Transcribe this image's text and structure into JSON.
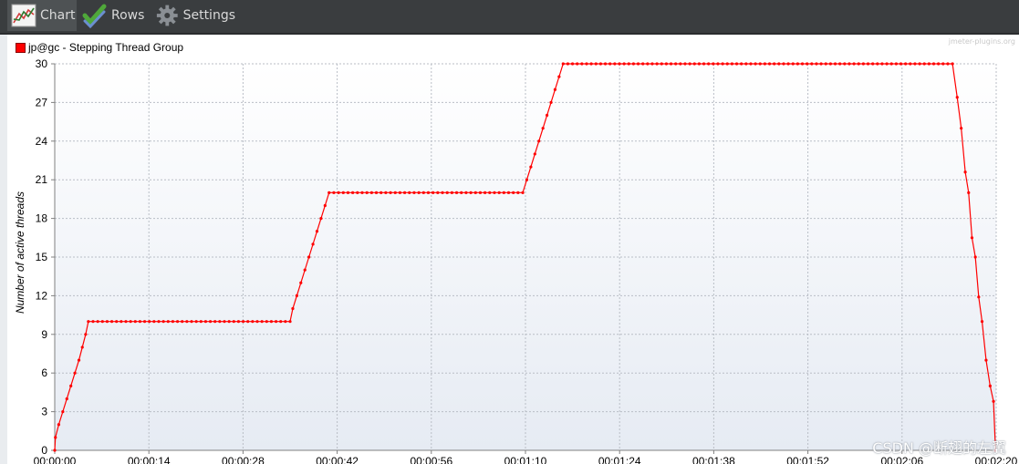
{
  "tabs": [
    {
      "label": "Chart",
      "icon": "chart-icon",
      "active": true
    },
    {
      "label": "Rows",
      "icon": "rows-check-icon",
      "active": false
    },
    {
      "label": "Settings",
      "icon": "gear-icon",
      "active": false
    }
  ],
  "watermark": "jmeter-plugins.org",
  "csdn_watermark": "CSDN @断翅的左翼",
  "chart_data": {
    "type": "line",
    "title": "",
    "xlabel": "",
    "ylabel": "Number of active threads",
    "ylim": [
      0,
      30
    ],
    "yticks": [
      "0",
      "3",
      "6",
      "9",
      "12",
      "15",
      "18",
      "21",
      "24",
      "27",
      "30"
    ],
    "xticks": [
      "00:00:00",
      "00:00:14",
      "00:00:28",
      "00:00:42",
      "00:00:56",
      "00:01:10",
      "00:01:24",
      "00:01:38",
      "00:01:52",
      "00:02:06",
      "00:02:20"
    ],
    "xlim_seconds": [
      0,
      140
    ],
    "grid": true,
    "legend_position": "top-left",
    "series": [
      {
        "name": "jp@gc - Stepping Thread Group",
        "color": "#ff0000",
        "points": [
          [
            0,
            0
          ],
          [
            0.1,
            1
          ],
          [
            0.6,
            2
          ],
          [
            1.2,
            3
          ],
          [
            1.8,
            4
          ],
          [
            2.4,
            5
          ],
          [
            3.0,
            6
          ],
          [
            3.6,
            7
          ],
          [
            4.1,
            8
          ],
          [
            4.6,
            9
          ],
          [
            5.0,
            10
          ],
          [
            35,
            10
          ],
          [
            35.4,
            11
          ],
          [
            36,
            12
          ],
          [
            36.6,
            13
          ],
          [
            37.2,
            14
          ],
          [
            37.8,
            15
          ],
          [
            38.4,
            16
          ],
          [
            39,
            17
          ],
          [
            39.6,
            18
          ],
          [
            40.2,
            19
          ],
          [
            40.8,
            20
          ],
          [
            69.6,
            20
          ],
          [
            70.2,
            21
          ],
          [
            70.8,
            22
          ],
          [
            71.4,
            23
          ],
          [
            72,
            24
          ],
          [
            72.6,
            25
          ],
          [
            73.2,
            26
          ],
          [
            73.8,
            27
          ],
          [
            74.4,
            28
          ],
          [
            75,
            29
          ],
          [
            75.6,
            30
          ],
          [
            133.5,
            30
          ],
          [
            134.2,
            27.4
          ],
          [
            134.8,
            25
          ],
          [
            135.4,
            21.6
          ],
          [
            135.9,
            20
          ],
          [
            136.4,
            16.5
          ],
          [
            136.9,
            15
          ],
          [
            137.4,
            11.9
          ],
          [
            137.9,
            10
          ],
          [
            138.5,
            7
          ],
          [
            139.1,
            5
          ],
          [
            139.6,
            3.8
          ],
          [
            139.9,
            0
          ]
        ]
      }
    ]
  }
}
